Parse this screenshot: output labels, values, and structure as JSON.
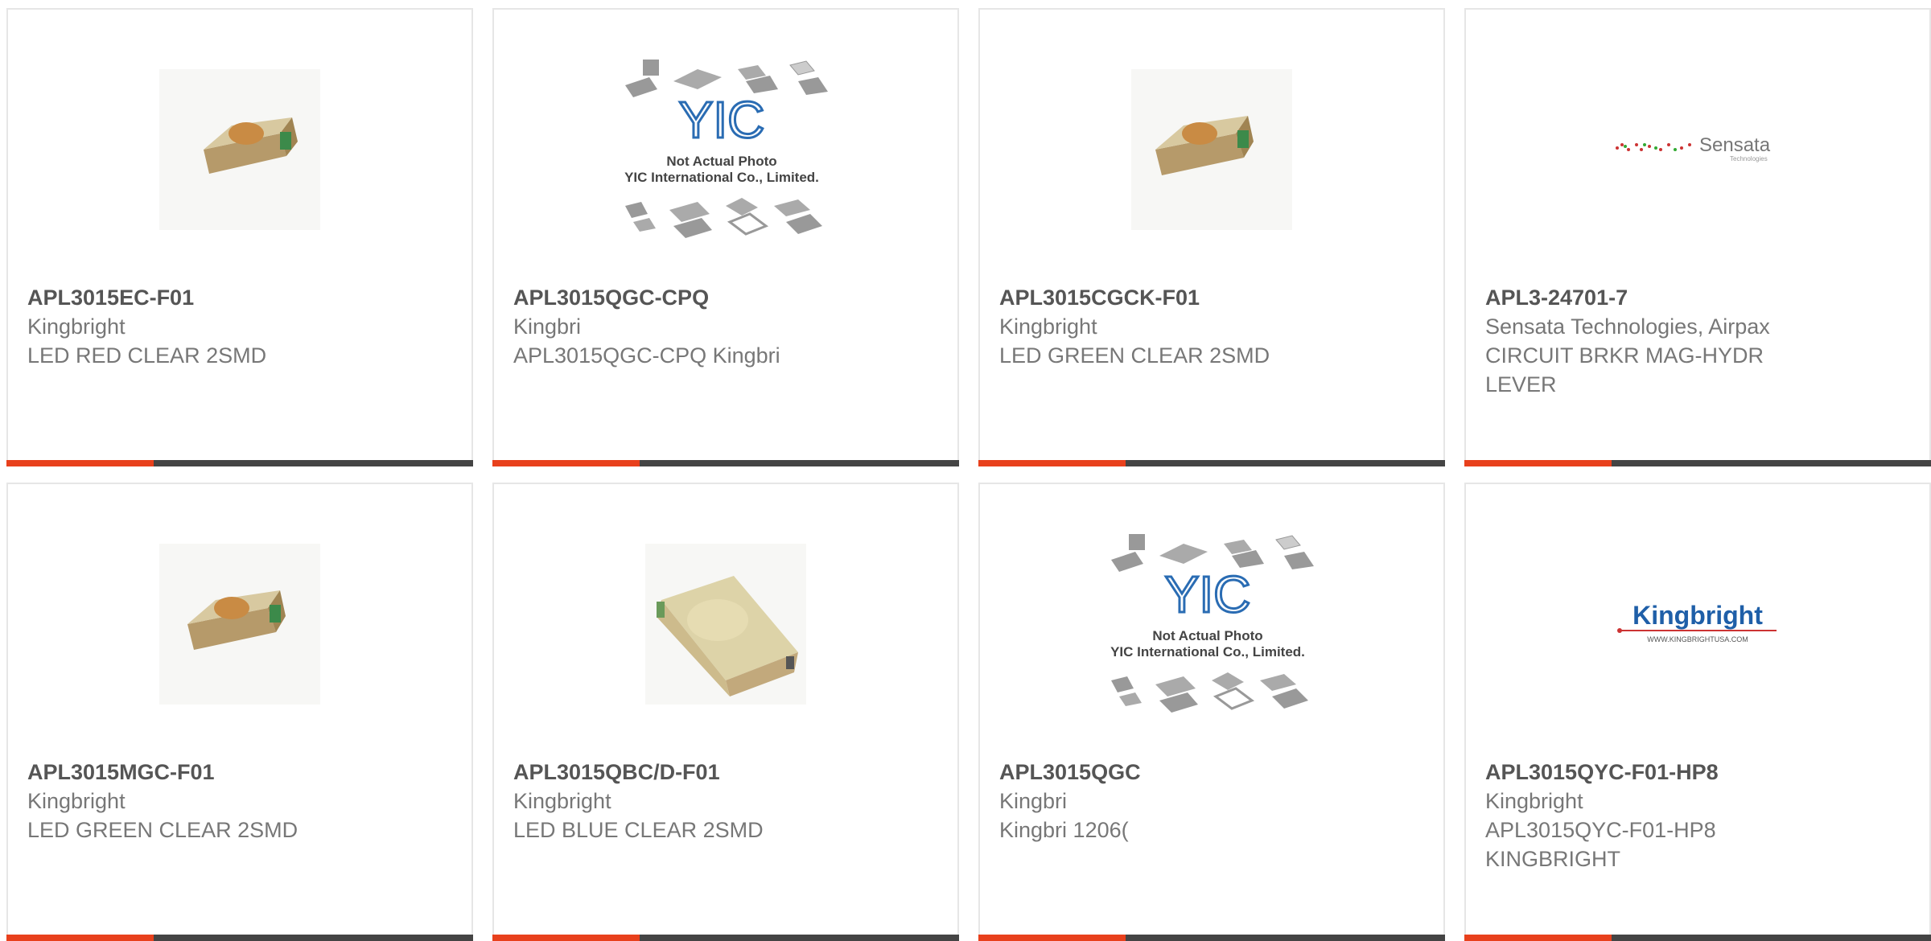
{
  "colors": {
    "accent": "#e8401c",
    "bar": "#444444",
    "border": "#e6e6e6",
    "title": "#555555",
    "text": "#777777"
  },
  "products": [
    {
      "part_number": "APL3015EC-F01",
      "manufacturer": "Kingbright",
      "description": "LED RED CLEAR 2SMD",
      "image": "led-chip-photo"
    },
    {
      "part_number": "APL3015QGC-CPQ",
      "manufacturer": "Kingbri",
      "description": "APL3015QGC-CPQ Kingbri",
      "image": "placeholder-photo"
    },
    {
      "part_number": "APL3015CGCK-F01",
      "manufacturer": "Kingbright",
      "description": "LED GREEN CLEAR 2SMD",
      "image": "led-chip-photo"
    },
    {
      "part_number": "APL3-24701-7",
      "manufacturer": "Sensata Technologies, Airpax",
      "description": "CIRCUIT BRKR MAG-HYDR LEVER",
      "image": "sensata-logo"
    },
    {
      "part_number": "APL3015MGC-F01",
      "manufacturer": "Kingbright",
      "description": "LED GREEN CLEAR 2SMD",
      "image": "led-chip-photo"
    },
    {
      "part_number": "APL3015QBC/D-F01",
      "manufacturer": "Kingbright",
      "description": "LED BLUE CLEAR 2SMD",
      "image": "led-chip-large-photo"
    },
    {
      "part_number": "APL3015QGC",
      "manufacturer": "Kingbri",
      "description": "Kingbri 1206(",
      "image": "placeholder-photo"
    },
    {
      "part_number": "APL3015QYC-F01-HP8",
      "manufacturer": "Kingbright",
      "description": "APL3015QYC-F01-HP8 KINGBRIGHT",
      "image": "kingbright-logo"
    }
  ],
  "placeholder_image": {
    "logo_text": "YIC",
    "line1": "Not Actual Photo",
    "line2": "YIC International Co., Limited."
  },
  "sensata_logo": {
    "name": "Sensata",
    "tagline": "Technologies"
  },
  "kingbright_logo": {
    "name": "Kingbright",
    "url": "WWW.KINGBRIGHTUSA.COM"
  }
}
